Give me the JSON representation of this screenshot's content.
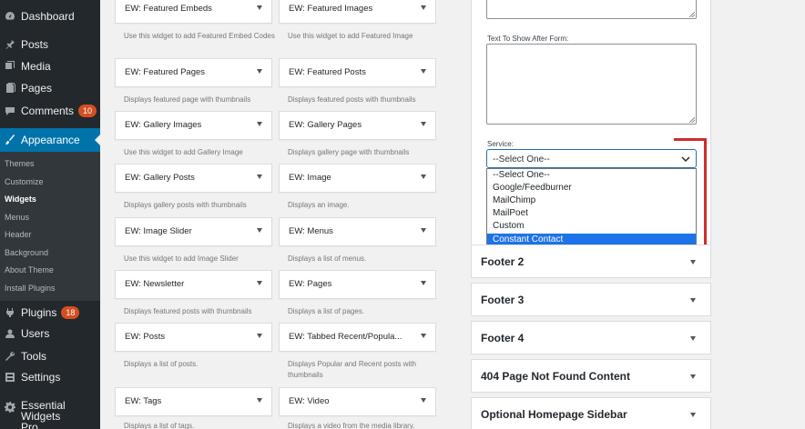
{
  "sidebar": {
    "items": [
      {
        "label": "Dashboard",
        "icon": "dashboard-icon"
      },
      {
        "label": "Posts",
        "icon": "pin-icon"
      },
      {
        "label": "Media",
        "icon": "media-icon"
      },
      {
        "label": "Pages",
        "icon": "page-icon"
      },
      {
        "label": "Comments",
        "icon": "comment-icon",
        "badge": "10"
      },
      {
        "label": "Appearance",
        "icon": "brush-icon"
      },
      {
        "label": "Plugins",
        "icon": "plugin-icon",
        "badge": "18"
      },
      {
        "label": "Users",
        "icon": "user-icon"
      },
      {
        "label": "Tools",
        "icon": "wrench-icon"
      },
      {
        "label": "Settings",
        "icon": "settings-icon"
      },
      {
        "label": "Essential Widgets",
        "label2": "Pro",
        "icon": "gear-icon"
      }
    ],
    "submenu": [
      "Themes",
      "Customize",
      "Widgets",
      "Menus",
      "Header",
      "Background",
      "About Theme",
      "Install Plugins"
    ],
    "accent_color": "#0073aa"
  },
  "widgets": {
    "left": [
      {
        "title": "EW: Featured Embeds",
        "desc": "Use this widget to add Featured Embed Codes"
      },
      {
        "title": "EW: Featured Pages",
        "desc": "Displays featured page with thumbnails"
      },
      {
        "title": "EW: Gallery Images",
        "desc": "Use this widget to add Gallery Image"
      },
      {
        "title": "EW: Gallery Posts",
        "desc": "Displays gallery posts with thumbnails"
      },
      {
        "title": "EW: Image Slider",
        "desc": "Use this widget to add Image Slider"
      },
      {
        "title": "EW: Newsletter",
        "desc": "Displays featured posts with thumbnails"
      },
      {
        "title": "EW: Posts",
        "desc": "Displays a list of posts."
      },
      {
        "title": "EW: Tags",
        "desc": "Displays a list of tags."
      }
    ],
    "right": [
      {
        "title": "EW: Featured Images",
        "desc": "Use this widget to add Featured Image"
      },
      {
        "title": "EW: Featured Posts",
        "desc": "Displays featured posts with thumbnails"
      },
      {
        "title": "EW: Gallery Pages",
        "desc": "Displays gallery page with thumbnails"
      },
      {
        "title": "EW: Image",
        "desc": "Displays an image."
      },
      {
        "title": "EW: Menus",
        "desc": "Displays a list of menus."
      },
      {
        "title": "EW: Pages",
        "desc": "Displays a list of pages."
      },
      {
        "title": "EW: Tabbed Recent/Popula...",
        "desc": "Displays Popular and Recent posts with thumbnails"
      },
      {
        "title": "EW: Video",
        "desc": "Displays a video from the media library."
      }
    ]
  },
  "form": {
    "after_label": "Text To Show After Form:",
    "service_label": "Service:",
    "service_value": "--Select One--",
    "options": [
      "--Select One--",
      "Google/Feedburner",
      "MailChimp",
      "MailPoet",
      "Custom",
      "Constant Contact"
    ],
    "highlighted_option": "Constant Contact"
  },
  "sidebars": [
    "Footer 2",
    "Footer 3",
    "Footer 4",
    "404 Page Not Found Content",
    "Optional Homepage Sidebar"
  ],
  "colors": {
    "highlight": "#1e73e8",
    "annotation": "#d02b2b",
    "badge": "#d54e21"
  }
}
